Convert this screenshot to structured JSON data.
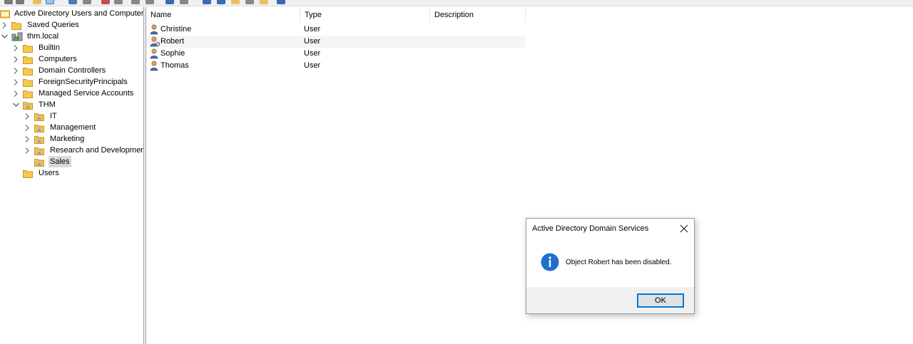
{
  "tree": {
    "root_label": "Active Directory Users and Computers [",
    "items": [
      {
        "label": "Saved Queries",
        "chevron": "right"
      },
      {
        "label": "thm.local",
        "chevron": "down"
      },
      {
        "label": "Builtin",
        "chevron": "right"
      },
      {
        "label": "Computers",
        "chevron": "right"
      },
      {
        "label": "Domain Controllers",
        "chevron": "right"
      },
      {
        "label": "ForeignSecurityPrincipals",
        "chevron": "right"
      },
      {
        "label": "Managed Service Accounts",
        "chevron": "right"
      },
      {
        "label": "THM",
        "chevron": "down"
      },
      {
        "label": "IT",
        "chevron": "right"
      },
      {
        "label": "Management",
        "chevron": "right"
      },
      {
        "label": "Marketing",
        "chevron": "right"
      },
      {
        "label": "Research and Development",
        "chevron": "right"
      },
      {
        "label": "Sales",
        "chevron": "none",
        "selected": true
      },
      {
        "label": "Users",
        "chevron": "none"
      }
    ]
  },
  "list": {
    "columns": [
      "Name",
      "Type",
      "Description"
    ],
    "rows": [
      {
        "name": "Christine",
        "type": "User",
        "description": ""
      },
      {
        "name": "Robert",
        "type": "User",
        "description": ""
      },
      {
        "name": "Sophie",
        "type": "User",
        "description": ""
      },
      {
        "name": "Thomas",
        "type": "User",
        "description": ""
      }
    ]
  },
  "dialog": {
    "title": "Active Directory Domain Services",
    "message": "Object Robert has been disabled.",
    "ok_label": "OK",
    "icon": "info-icon"
  },
  "colors": {
    "accent": "#0078d7",
    "folder": "#f5c94a",
    "selection": "#d9d9d9"
  }
}
